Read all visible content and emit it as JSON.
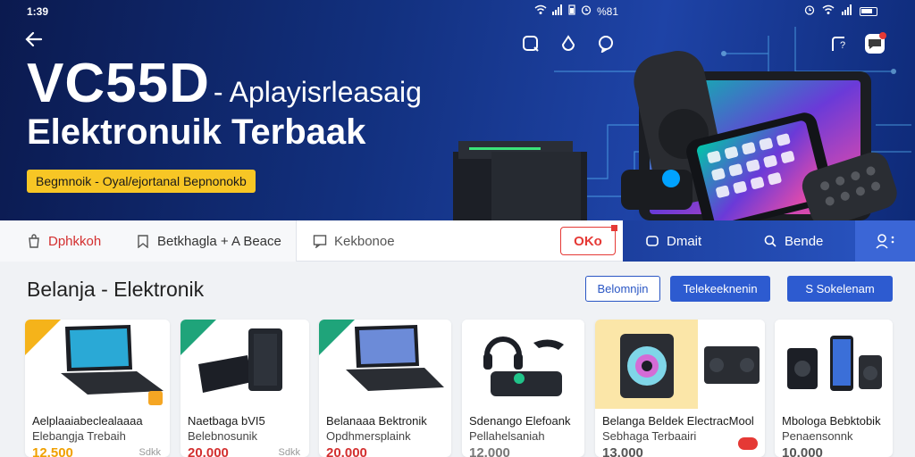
{
  "status_bar": {
    "time_left": "1:39",
    "signal_right": "%81"
  },
  "hero": {
    "title_big": "VC55D",
    "title_rest": "- Aplayisrleasaig",
    "subtitle": "Elektronuik Terbaak",
    "badge": "Begmnoik - Oyal/ejortanal Bepnonokb"
  },
  "nav": {
    "tab1": "Dphkkoh",
    "tab2": "Betkhagla + A Beace",
    "tab3": "Kekbonoe",
    "promo": "OKo",
    "blue1": "Dmait",
    "blue2": "Bende"
  },
  "section": {
    "title": "Belanja - Elektronik",
    "btn1": "Belomnjin",
    "btn2": "Telekeeknenin",
    "btn3": "S Sokelenam"
  },
  "products": [
    {
      "name1": "Aelplaaiabeclealaaaa",
      "name2": "Elebangja Trebaih",
      "price": "12.500",
      "small": "Sdkk",
      "price_color": "#f0a000"
    },
    {
      "name1": "Naetbaga bVI5",
      "name2": "Belebnosunik",
      "price": "20.000",
      "small": "Sdkk",
      "price_color": "#d32f2f"
    },
    {
      "name1": "Belanaaa Bektronik",
      "name2": "Opdhmersplaink",
      "price": "20.000",
      "small": "",
      "price_color": "#d32f2f"
    },
    {
      "name1": "Sdenango Elefoank",
      "name2": "Pellahelsaniah",
      "price": "12.000",
      "small": "",
      "price_color": "#777"
    },
    {
      "name1": "Belanga Beldek ElectracMool",
      "name2": "Sebhaga Terbaairi",
      "price": "13.000",
      "small": "",
      "price_color": "#555"
    },
    {
      "name1": "Mbologa Bebktobik",
      "name2": "Penaensonnk",
      "price": "10.000",
      "small": "",
      "price_color": "#555"
    }
  ]
}
